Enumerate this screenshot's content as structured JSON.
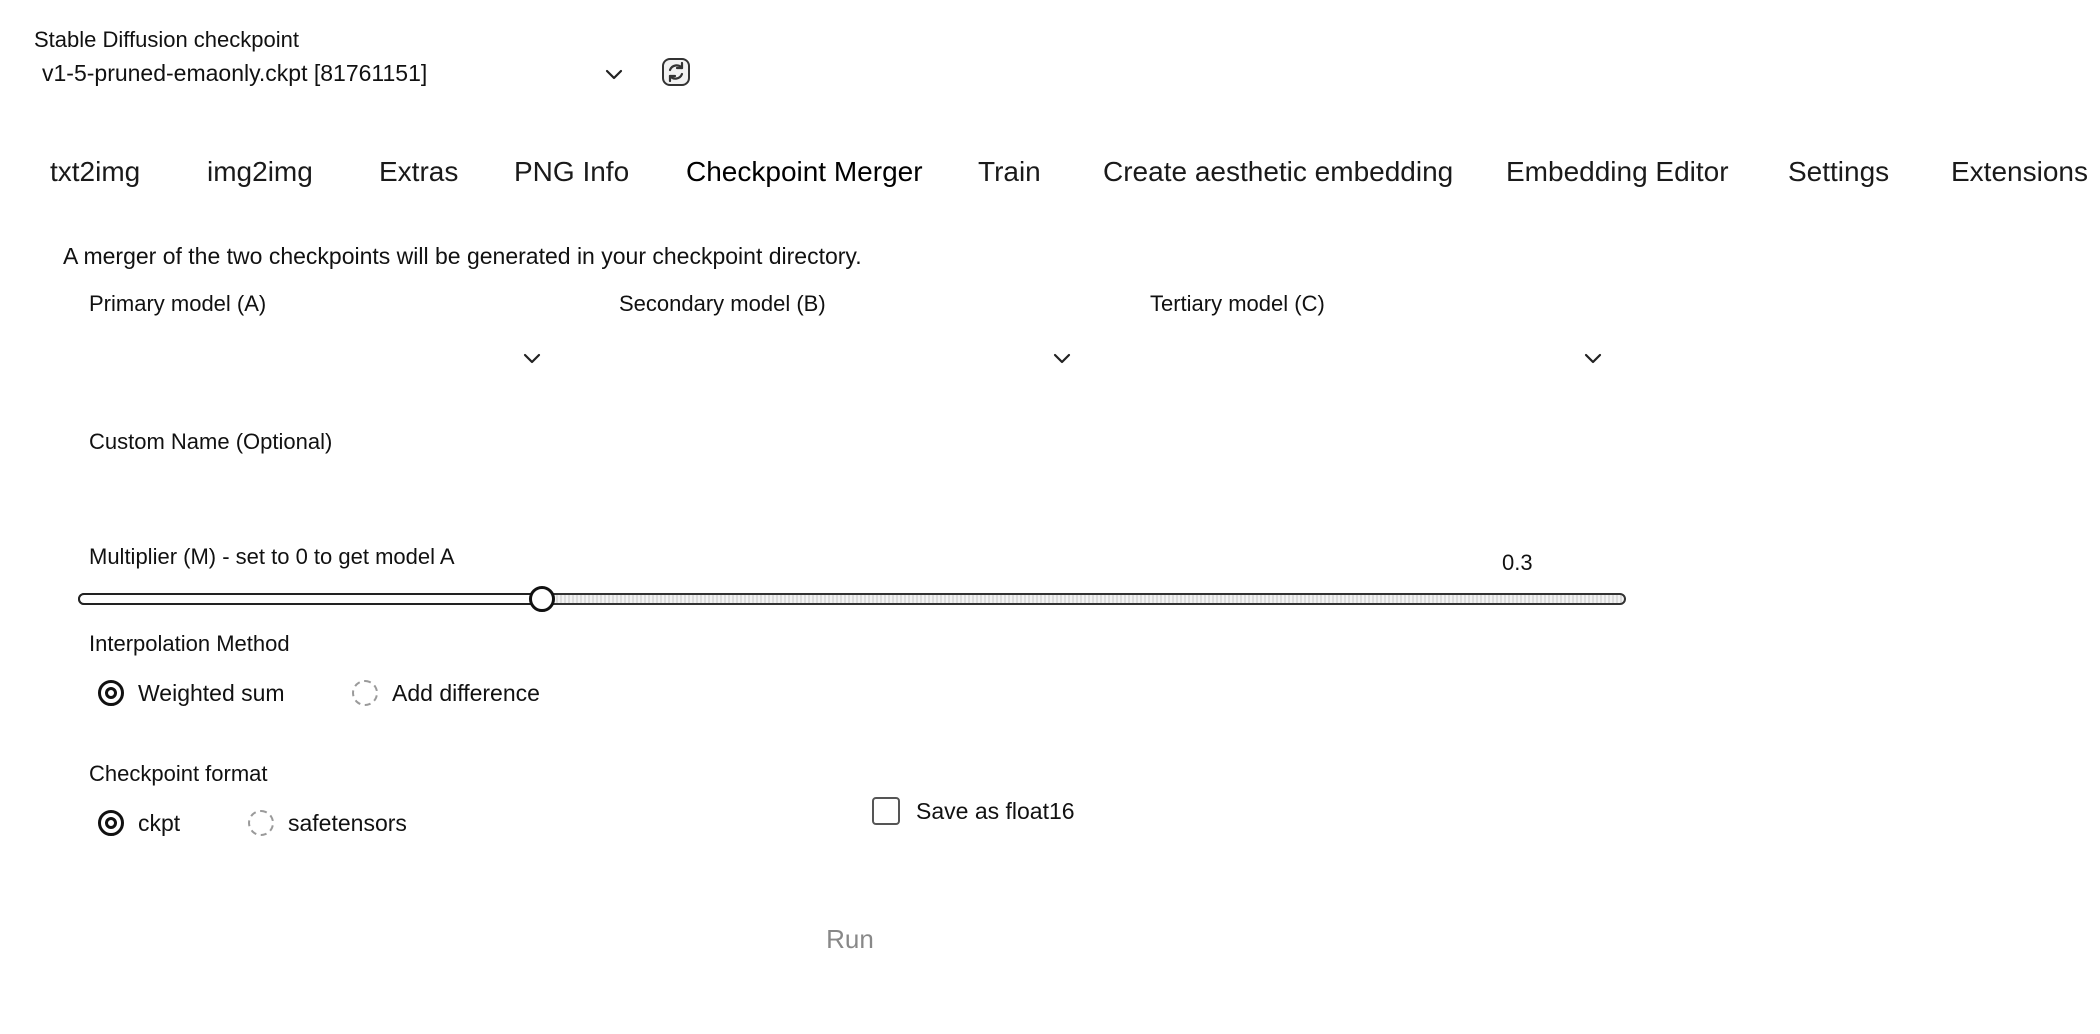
{
  "checkpoint": {
    "label": "Stable Diffusion checkpoint",
    "selected": "v1-5-pruned-emaonly.ckpt [81761151]"
  },
  "tabs": [
    {
      "label": "txt2img"
    },
    {
      "label": "img2img"
    },
    {
      "label": "Extras"
    },
    {
      "label": "PNG Info"
    },
    {
      "label": "Checkpoint Merger",
      "active": true
    },
    {
      "label": "Train"
    },
    {
      "label": "Create aesthetic embedding"
    },
    {
      "label": "Embedding Editor"
    },
    {
      "label": "Settings"
    },
    {
      "label": "Extensions"
    }
  ],
  "merger": {
    "description": "A merger of the two checkpoints will be generated in your checkpoint directory.",
    "primary_label": "Primary model (A)",
    "primary_value": "",
    "secondary_label": "Secondary model (B)",
    "secondary_value": "",
    "tertiary_label": "Tertiary model (C)",
    "tertiary_value": "",
    "custom_name_label": "Custom Name (Optional)",
    "custom_name_value": "",
    "multiplier_label": "Multiplier (M) - set to 0 to get model A",
    "multiplier_value": "0.3",
    "multiplier_min": 0,
    "multiplier_max": 1,
    "interpolation_label": "Interpolation Method",
    "interpolation_options": [
      {
        "label": "Weighted sum",
        "checked": true
      },
      {
        "label": "Add difference",
        "checked": false
      }
    ],
    "format_label": "Checkpoint format",
    "format_options": [
      {
        "label": "ckpt",
        "checked": true
      },
      {
        "label": "safetensors",
        "checked": false
      }
    ],
    "float16_label": "Save as float16",
    "float16_checked": false,
    "run_label": "Run"
  },
  "icons": {
    "dropdown": "chevron-down-icon",
    "refresh": "refresh-icon"
  }
}
